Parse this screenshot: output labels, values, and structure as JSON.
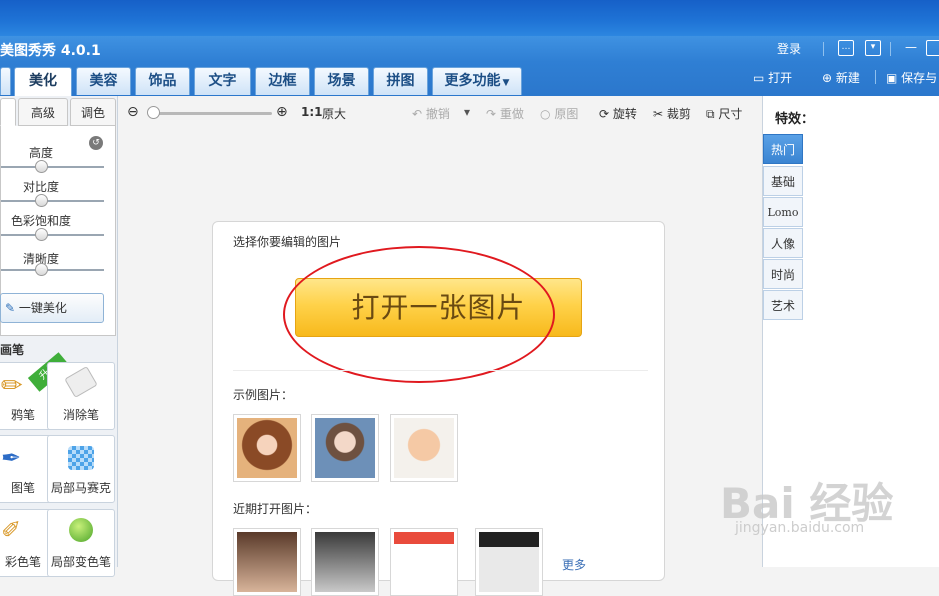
{
  "app": {
    "title": "美图秀秀 4.0.1",
    "login": "登录"
  },
  "nav": {
    "tabs": [
      "美化",
      "美容",
      "饰品",
      "文字",
      "边框",
      "场景",
      "拼图",
      "更多功能"
    ],
    "open": "打开",
    "new": "新建",
    "save": "保存与"
  },
  "left": {
    "tabs": [
      "高级",
      "调色"
    ],
    "sliders": [
      "高度",
      "对比度",
      "色彩饱和度",
      "清晰度"
    ],
    "onekey": "一键美化",
    "brush_heading": "画笔",
    "badge": "升级",
    "tools": [
      "鸦笔",
      "消除笔",
      "图笔",
      "局部马赛克",
      "彩色笔",
      "局部变色笔"
    ]
  },
  "toolbar": {
    "zoom_ratio": "1:1",
    "original_size": "原大",
    "undo": "撤销",
    "redo": "重做",
    "original": "原图",
    "rotate": "旋转",
    "crop": "裁剪",
    "size": "尺寸"
  },
  "card": {
    "prompt": "选择你要编辑的图片",
    "open_button": "打开一张图片",
    "samples_label": "示例图片：",
    "recent_label": "近期打开图片：",
    "more": "更多"
  },
  "effects": {
    "title": "特效：",
    "tabs": [
      "热门",
      "基础",
      "Lomo",
      "人像",
      "时尚",
      "艺术"
    ]
  },
  "watermark": {
    "brand": "Bai 经验",
    "url": "jingyan.baidu.com"
  }
}
